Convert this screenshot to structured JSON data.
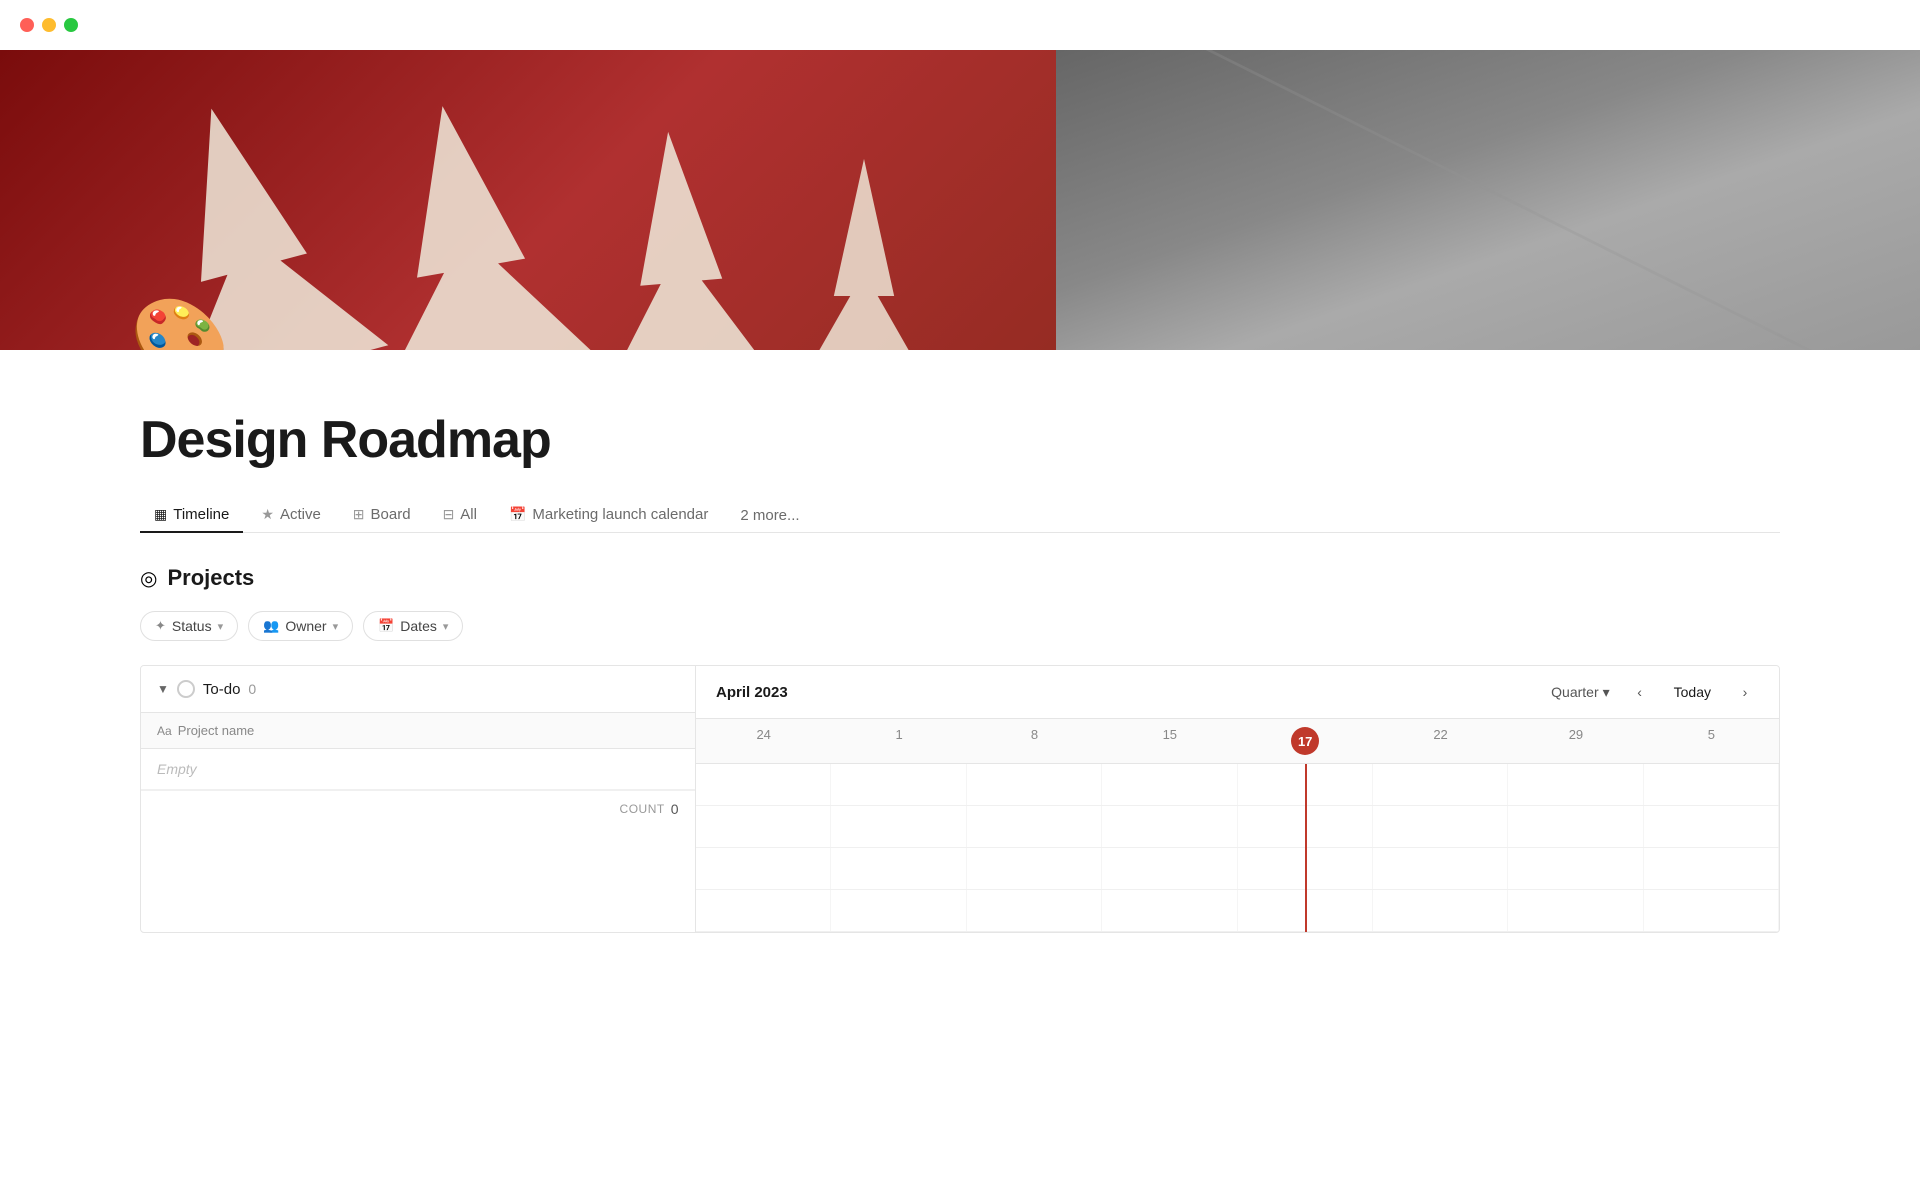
{
  "window": {
    "traffic_lights": [
      "red",
      "yellow",
      "green"
    ]
  },
  "page": {
    "icon": "🎨",
    "title": "Design Roadmap"
  },
  "tabs": [
    {
      "id": "timeline",
      "label": "Timeline",
      "icon": "▦",
      "active": true
    },
    {
      "id": "active",
      "label": "Active",
      "icon": "★",
      "active": false
    },
    {
      "id": "board",
      "label": "Board",
      "icon": "⊞",
      "active": false
    },
    {
      "id": "all",
      "label": "All",
      "icon": "⊟",
      "active": false
    },
    {
      "id": "marketing",
      "label": "Marketing launch calendar",
      "icon": "📅",
      "active": false
    }
  ],
  "tabs_more": "2 more...",
  "section": {
    "icon": "◎",
    "title": "Projects"
  },
  "filters": [
    {
      "id": "status",
      "icon": "✦",
      "label": "Status"
    },
    {
      "id": "owner",
      "icon": "👥",
      "label": "Owner"
    },
    {
      "id": "dates",
      "icon": "📅",
      "label": "Dates"
    }
  ],
  "group": {
    "label": "To-do",
    "count": 0
  },
  "columns": {
    "project_name": {
      "icon": "Aa",
      "label": "Project name"
    }
  },
  "empty_row_label": "Empty",
  "count_label": "COUNT",
  "count_value": "0",
  "timeline": {
    "month": "April 2023",
    "view": "Quarter",
    "today_label": "Today",
    "today_date": "17",
    "dates": [
      "24",
      "1",
      "8",
      "15",
      "17",
      "22",
      "29",
      "5"
    ]
  }
}
